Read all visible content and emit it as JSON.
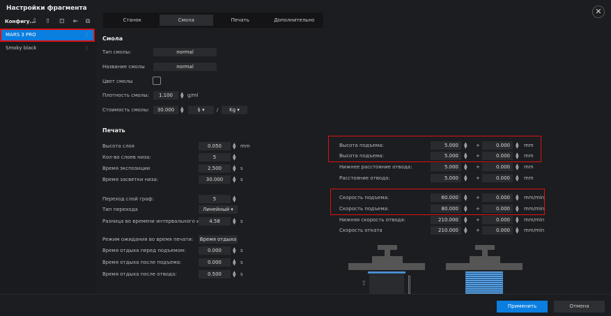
{
  "window": {
    "title": "Настройки фрагмента",
    "close_icon": "close-icon"
  },
  "sidebar": {
    "header": "Конфигу...",
    "icons": [
      "cloud-download-icon",
      "cloud-upload-icon",
      "import-icon",
      "export-icon",
      "copy-icon"
    ],
    "items": [
      {
        "label": "MARS 3 PRO",
        "selected": true
      },
      {
        "label": "Smoky black"
      }
    ]
  },
  "tabs": [
    {
      "label": "Станок"
    },
    {
      "label": "Смола",
      "active": true
    },
    {
      "label": "Печать"
    },
    {
      "label": "Дополнительно"
    }
  ],
  "resin": {
    "heading": "Смола",
    "type_label": "Тип смолы:",
    "type_value": "normal",
    "name_label": "Название смолы",
    "name_value": "normal",
    "color_label": "Цвет смолы",
    "density_label": "Плотность смолы:",
    "density_value": "1.100",
    "density_unit": "g/ml",
    "cost_label": "Стоимость смолы:",
    "cost_value": "30.000",
    "currency": "$",
    "slash": "/",
    "weight_unit": "Kg"
  },
  "print": {
    "heading": "Печать",
    "rows": [
      {
        "label": "Высота слоя",
        "value": "0.050",
        "unit": "mm"
      },
      {
        "label": "Кол-во слоев низа:",
        "value": "5",
        "unit": ""
      },
      {
        "label": "Время экспозиции",
        "value": "2.500",
        "unit": "s"
      },
      {
        "label": "Время засветки низа:",
        "value": "30.000",
        "unit": "s"
      },
      {
        "label": "Переход слой граф:",
        "value": "5",
        "unit": ""
      },
      {
        "label": "Тип перехода",
        "value": "Линейный",
        "unit": "",
        "dropdown": true
      },
      {
        "label": "Разница во времени интервального интерв...",
        "value": "4.58",
        "unit": "s",
        "disabled": true
      },
      {
        "label": "Режим ожидания во время печати:",
        "value": "Время отдыха",
        "unit": "",
        "dropdown": true
      },
      {
        "label": "Время отдыха перед подъемом:",
        "value": "0.000",
        "unit": "s"
      },
      {
        "label": "Время отдыха после подъема:",
        "value": "0.000",
        "unit": "s"
      },
      {
        "label": "Время отдыха после отвода:",
        "value": "0.500",
        "unit": "s"
      }
    ]
  },
  "motion": {
    "rows": [
      {
        "label": "Высота подъема:",
        "v1": "5.000",
        "op": "+",
        "v2": "0.000",
        "unit": "mm"
      },
      {
        "label": "Высота подъема:",
        "v1": "5.000",
        "op": "+",
        "v2": "0.000",
        "unit": "mm"
      },
      {
        "label": "Нижнее расстояние отвода:",
        "v1": "5.000",
        "op": "+",
        "v2": "0.000",
        "unit": "mm",
        "disabled": true
      },
      {
        "label": "Расстояние отвода:",
        "v1": "5.000",
        "op": "+",
        "v2": "0.000",
        "unit": "mm",
        "disabled": true
      },
      {
        "label": "Скорость подъема:",
        "v1": "60.000",
        "op": "+",
        "v2": "0.000",
        "unit": "mm/min"
      },
      {
        "label": "Скорость подъема:",
        "v1": "80.000",
        "op": "+",
        "v2": "0.000",
        "unit": "mm/min"
      },
      {
        "label": "Нижняя скорость отвода:",
        "v1": "210.000",
        "op": "+",
        "v2": "0.000",
        "unit": "mm/min"
      },
      {
        "label": "Скорость отката",
        "v1": "210.000",
        "op": "+",
        "v2": "0.000",
        "unit": "mm/min"
      }
    ]
  },
  "footer": {
    "apply": "Применить",
    "cancel": "Отмена"
  },
  "colors": {
    "accent": "#0a7fe0",
    "highlight": "#dd1111"
  }
}
